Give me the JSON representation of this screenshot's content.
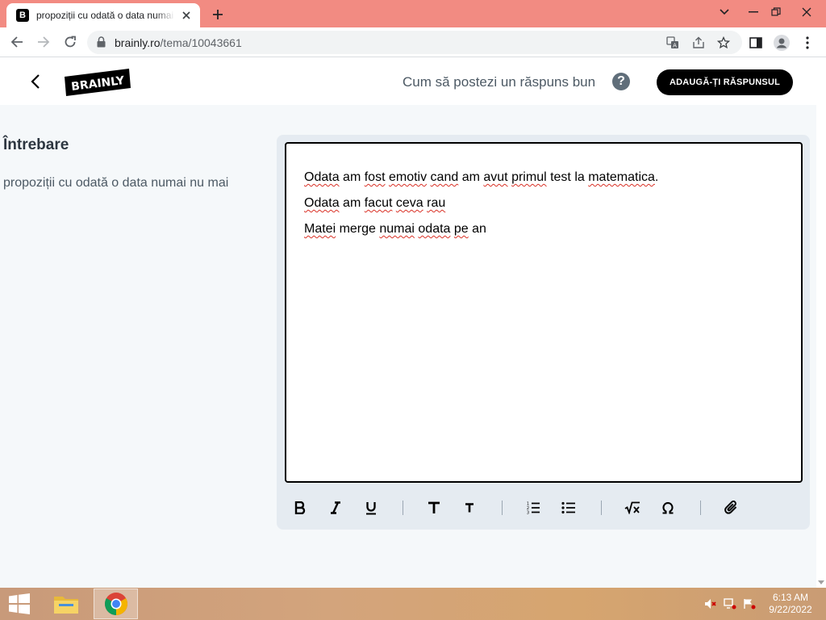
{
  "browser": {
    "tab_title": "propoziții cu odată o data numai nu mai - Brainly.ro",
    "favicon_letter": "B",
    "url_domain": "brainly.ro",
    "url_path": "/tema/10043661"
  },
  "header": {
    "logo_text": "BRAINLY",
    "how_to_label": "Cum să postezi un răspuns bun",
    "help_label": "?",
    "add_answer_label": "ADAUGĂ-ȚI RĂSPUNSUL"
  },
  "question": {
    "heading": "Întrebare",
    "text": "propoziții cu odată o data numai nu mai"
  },
  "editor": {
    "lines": [
      [
        {
          "t": "Odata",
          "sp": true
        },
        {
          "t": " am "
        },
        {
          "t": "fost",
          "sp": true
        },
        {
          "t": " "
        },
        {
          "t": "emotiv",
          "sp": true
        },
        {
          "t": " "
        },
        {
          "t": "cand",
          "sp": true
        },
        {
          "t": " am "
        },
        {
          "t": "avut",
          "sp": true
        },
        {
          "t": " "
        },
        {
          "t": "primul",
          "sp": true
        },
        {
          "t": " test la "
        },
        {
          "t": "matematica",
          "sp": true
        },
        {
          "t": "."
        }
      ],
      [
        {
          "t": "Odata",
          "sp": true
        },
        {
          "t": " am "
        },
        {
          "t": "facut",
          "sp": true
        },
        {
          "t": " "
        },
        {
          "t": "ceva",
          "sp": true
        },
        {
          "t": " "
        },
        {
          "t": "rau",
          "sp": true
        }
      ],
      [
        {
          "t": "Matei",
          "sp": true
        },
        {
          "t": " merge "
        },
        {
          "t": "numai",
          "sp": true
        },
        {
          "t": " "
        },
        {
          "t": "odata",
          "sp": true
        },
        {
          "t": " "
        },
        {
          "t": "pe",
          "sp": true
        },
        {
          "t": " an"
        }
      ]
    ],
    "toolbar_icons": [
      "bold-icon",
      "italic-icon",
      "underline-icon",
      "heading-large-icon",
      "heading-small-icon",
      "ordered-list-icon",
      "bullet-list-icon",
      "math-icon",
      "symbol-icon",
      "attachment-icon"
    ]
  },
  "taskbar": {
    "time": "6:13 AM",
    "date": "9/22/2022"
  },
  "colors": {
    "tabstrip": "#f28b82",
    "page_bg": "#f5f8fa",
    "editor_panel": "#e5ebf1",
    "spell_underline": "#d93025",
    "primary_button": "#000000"
  }
}
